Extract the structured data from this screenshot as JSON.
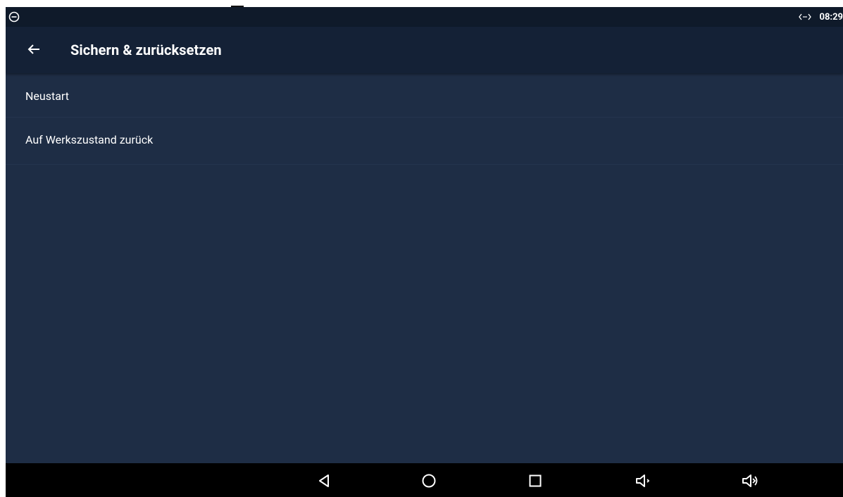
{
  "status_bar": {
    "left_icon": "do-not-disturb-icon",
    "sync_icon": "data-sync-icon",
    "time": "08:29"
  },
  "app_bar": {
    "back_icon": "arrow-left-icon",
    "title": "Sichern & zurücksetzen"
  },
  "list": {
    "items": [
      {
        "label": "Neustart"
      },
      {
        "label": "Auf Werkszustand zurück"
      }
    ]
  },
  "nav_bar": {
    "buttons": [
      "back-triangle-icon",
      "home-circle-icon",
      "recents-square-icon",
      "volume-down-icon",
      "volume-up-icon"
    ]
  },
  "colors": {
    "background": "#1e2d45",
    "app_bar": "#142136",
    "status_bar": "#0f1a2a",
    "nav_bar": "#000000",
    "text": "#ffffff"
  }
}
